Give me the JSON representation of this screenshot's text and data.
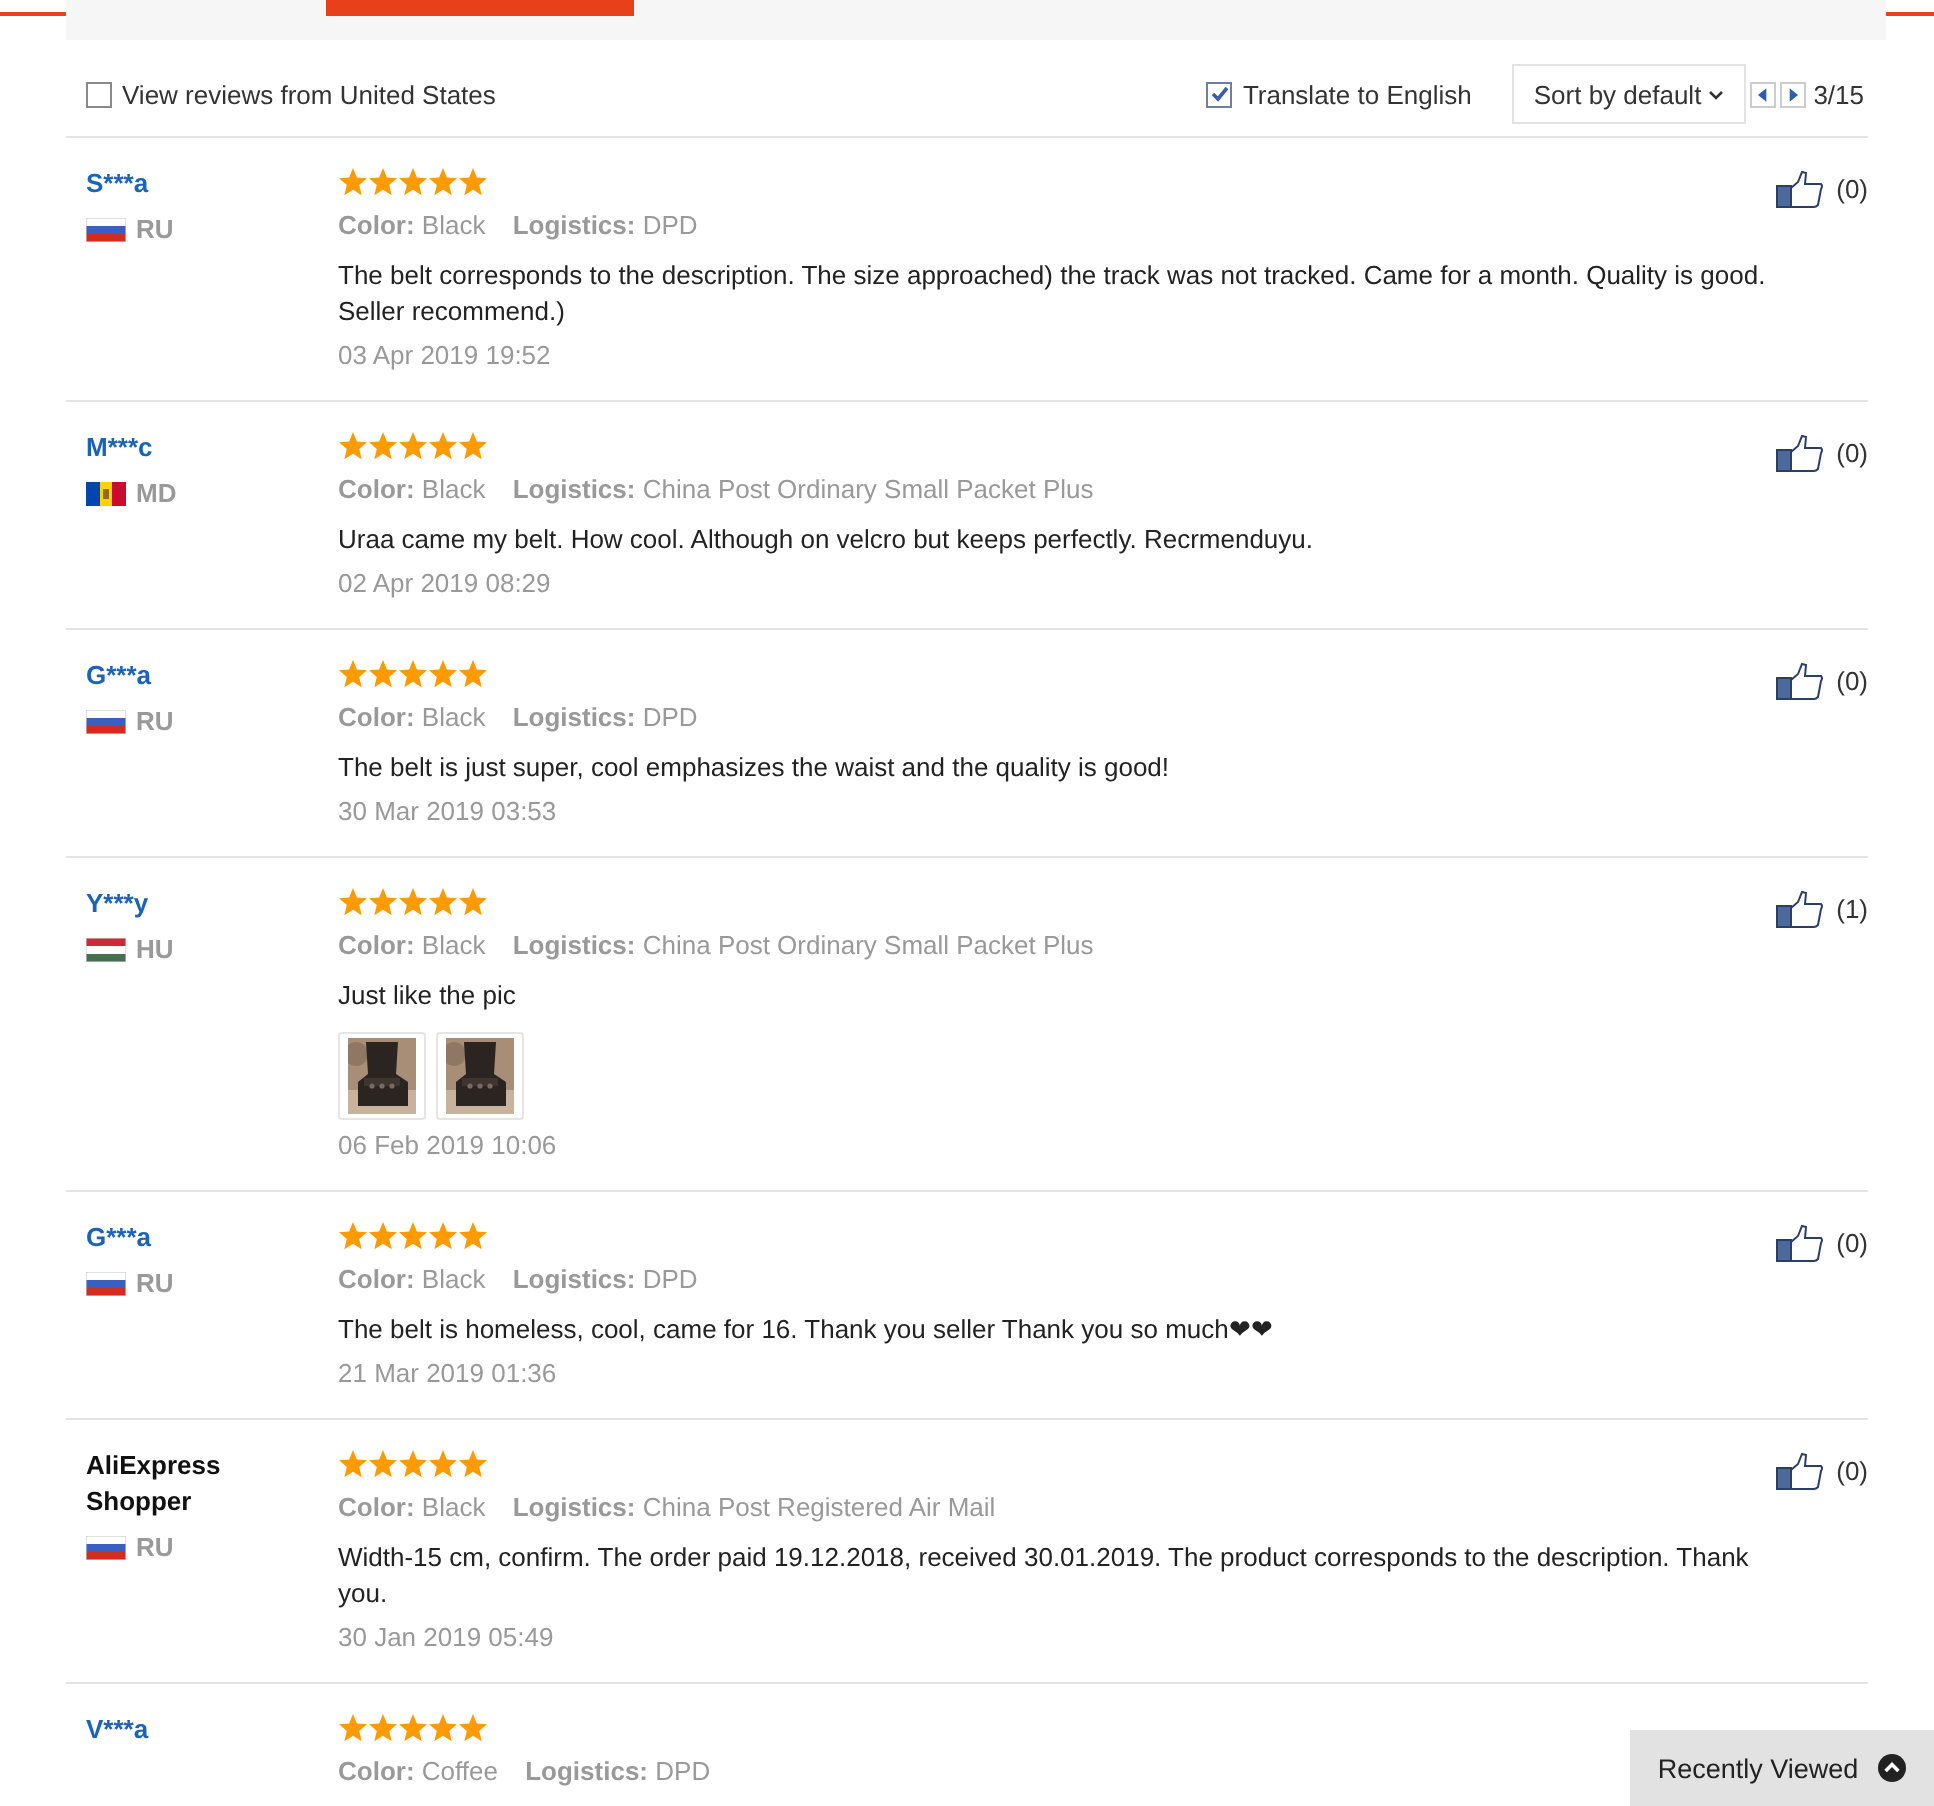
{
  "filters": {
    "from_country": {
      "label": "View reviews from United States",
      "checked": false
    },
    "translate": {
      "label": "Translate to English",
      "checked": true
    },
    "sort": {
      "value": "Sort by default"
    },
    "pager": {
      "text": "3/15"
    }
  },
  "reviews": [
    {
      "name": "S***a",
      "kind": "masked",
      "flag": {
        "kind": "ru"
      },
      "country": "RU",
      "stars": 5,
      "color_label": "Color:",
      "color_value": "Black",
      "logistics_label": "Logistics:",
      "logistics": "DPD",
      "text": "The belt corresponds to the description. The size approached) the track was not tracked. Came for a month. Quality is good. Seller recommend.)",
      "date": "03 Apr 2019 19:52",
      "likes": "(0)"
    },
    {
      "name": "M***c",
      "kind": "masked",
      "flag": {
        "kind": "md"
      },
      "country": "MD",
      "stars": 5,
      "color_label": "Color:",
      "color_value": "Black",
      "logistics_label": "Logistics:",
      "logistics": "China Post Ordinary Small Packet Plus",
      "text": "Uraa came my belt. How cool. Although on velcro but keeps perfectly. Recrmenduyu.",
      "date": "02 Apr 2019 08:29",
      "likes": "(0)"
    },
    {
      "name": "G***a",
      "kind": "masked",
      "flag": {
        "kind": "ru"
      },
      "country": "RU",
      "stars": 5,
      "color_label": "Color:",
      "color_value": "Black",
      "logistics_label": "Logistics:",
      "logistics": "DPD",
      "text": "The belt is just super, cool emphasizes the waist and the quality is good!",
      "date": "30 Mar 2019 03:53",
      "likes": "(0)"
    },
    {
      "name": "Y***y",
      "kind": "masked",
      "flag": {
        "kind": "hu"
      },
      "country": "HU",
      "stars": 5,
      "color_label": "Color:",
      "color_value": "Black",
      "logistics_label": "Logistics:",
      "logistics": "China Post Ordinary Small Packet Plus",
      "text": "Just like the pic",
      "photos": [
        {
          "kind": "picture"
        },
        {
          "kind": "picture"
        }
      ],
      "date": "06 Feb 2019 10:06",
      "likes": "(1)"
    },
    {
      "name": "G***a",
      "kind": "masked",
      "flag": {
        "kind": "ru"
      },
      "country": "RU",
      "stars": 5,
      "color_label": "Color:",
      "color_value": "Black",
      "logistics_label": "Logistics:",
      "logistics": "DPD",
      "text": "The belt is homeless, cool, came for 16. Thank you seller Thank you so much❤❤",
      "date": "21 Mar 2019 01:36",
      "likes": "(0)"
    },
    {
      "name": "AliExpress Shopper",
      "kind": "anonymous",
      "flag": {
        "kind": "ru"
      },
      "country": "RU",
      "stars": 5,
      "color_label": "Color:",
      "color_value": "Black",
      "logistics_label": "Logistics:",
      "logistics": "China Post Registered Air Mail",
      "text": "Width-15 cm, confirm. The order paid 19.12.2018, received 30.01.2019. The product corresponds to the description. Thank you.",
      "date": "30 Jan 2019 05:49",
      "likes": "(0)"
    },
    {
      "name": "V***a",
      "kind": "masked",
      "stars": 5,
      "color_label": "Color:",
      "color_value": "Coffee",
      "logistics_label": "Logistics:",
      "logistics": "DPD"
    }
  ],
  "recently_viewed": {
    "label": "Recently Viewed"
  }
}
